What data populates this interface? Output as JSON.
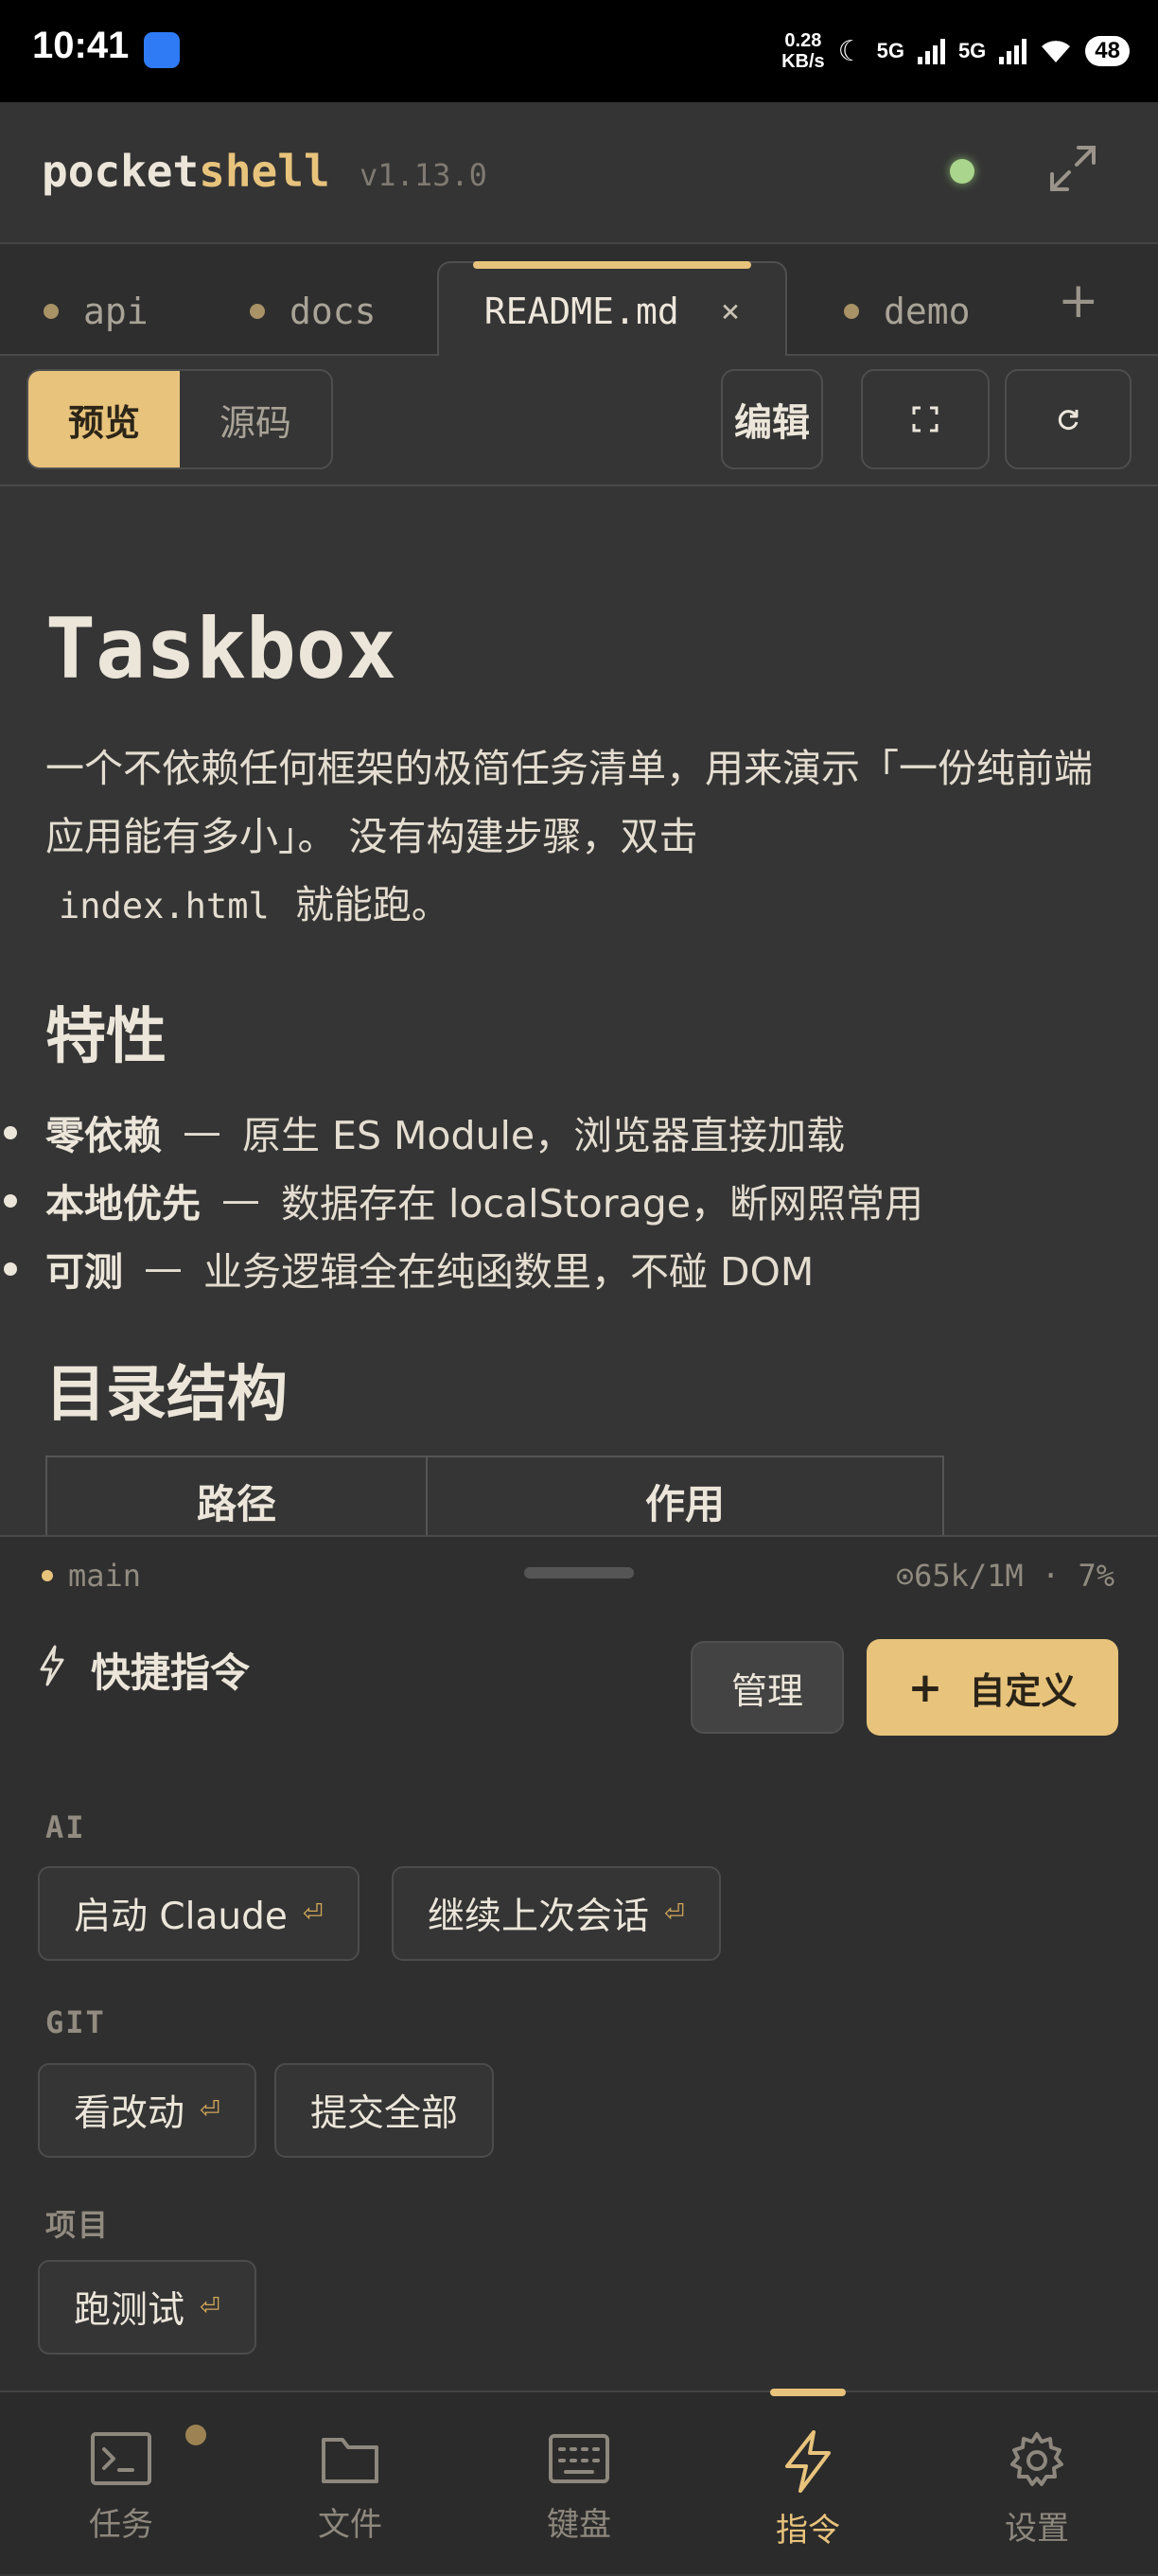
{
  "status_bar": {
    "time": "10:41",
    "speed_value": "0.28",
    "speed_unit": "KB/s",
    "network_1": "5G",
    "network_2": "5G",
    "battery": "48"
  },
  "header": {
    "brand_part1": "pocket",
    "brand_part2": "shell",
    "version": "v1.13.0",
    "status_color": "#a9d58c",
    "accent_color": "#e8c37c"
  },
  "tabs": [
    {
      "label": "api",
      "active": false
    },
    {
      "label": "docs",
      "active": false
    },
    {
      "label": "README.md",
      "active": true,
      "close": "×"
    },
    {
      "label": "demo",
      "active": false
    }
  ],
  "tab_add": "+",
  "toolbar": {
    "preview": "预览",
    "source": "源码",
    "edit": "编辑"
  },
  "document": {
    "title": "Taskbox",
    "intro_1": "一个不依赖任何框架的极简任务清单，用来演示「一份纯前端应用能有多小」。 没有构建步骤，双击",
    "intro_code": "index.html",
    "intro_2": "就能跑。",
    "features_heading": "特性",
    "features": [
      {
        "bold": "零依赖",
        "dash": "—",
        "text": "原生 ES Module，浏览器直接加载"
      },
      {
        "bold": "本地优先",
        "dash": "—",
        "text": "数据存在 localStorage，断网照常用"
      },
      {
        "bold": "可测",
        "dash": "—",
        "text": "业务逻辑全在纯函数里，不碰 DOM"
      }
    ],
    "structure_heading": "目录结构",
    "table_headers": [
      "路径",
      "作用"
    ]
  },
  "panel": {
    "branch": "main",
    "tokens": "⊙65k/1M · 7%",
    "title": "快捷指令",
    "manage": "管理",
    "custom_plus": "+",
    "custom": "自定义",
    "groups": [
      {
        "name": "AI",
        "commands": [
          {
            "label": "启动 Claude",
            "enter": "⏎"
          },
          {
            "label": "继续上次会话",
            "enter": "⏎"
          }
        ]
      },
      {
        "name": "GIT",
        "commands": [
          {
            "label": "看改动",
            "enter": "⏎"
          },
          {
            "label": "提交全部",
            "enter": ""
          }
        ]
      },
      {
        "name": "项目",
        "commands": [
          {
            "label": "跑测试",
            "enter": "⏎"
          }
        ]
      }
    ]
  },
  "nav": [
    {
      "label": "任务",
      "icon": "terminal-icon",
      "active": false
    },
    {
      "label": "文件",
      "icon": "folder-icon",
      "active": false
    },
    {
      "label": "键盘",
      "icon": "keyboard-icon",
      "active": false
    },
    {
      "label": "指令",
      "icon": "lightning-icon",
      "active": true
    },
    {
      "label": "设置",
      "icon": "gear-icon",
      "active": false
    }
  ]
}
